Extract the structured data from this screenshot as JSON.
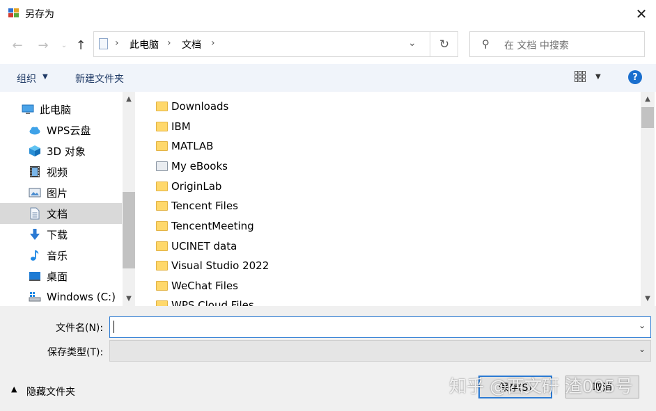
{
  "window": {
    "title": "另存为",
    "close_glyph": "✕"
  },
  "address_bar": {
    "crumbs": [
      "此电脑",
      "文档"
    ],
    "search_placeholder": "在 文档 中搜索"
  },
  "toolbar": {
    "organize_label": "组织",
    "new_folder_label": "新建文件夹",
    "help_label": "?"
  },
  "nav_pane": {
    "items": [
      {
        "label": "此电脑",
        "icon": "computer-icon"
      },
      {
        "label": "WPS云盘",
        "icon": "cloud-icon"
      },
      {
        "label": "3D 对象",
        "icon": "3d-objects-icon"
      },
      {
        "label": "视频",
        "icon": "video-icon"
      },
      {
        "label": "图片",
        "icon": "pictures-icon"
      },
      {
        "label": "文档",
        "icon": "documents-icon",
        "selected": true
      },
      {
        "label": "下载",
        "icon": "download-icon"
      },
      {
        "label": "音乐",
        "icon": "music-icon"
      },
      {
        "label": "桌面",
        "icon": "desktop-icon"
      },
      {
        "label": "Windows (C:)",
        "icon": "drive-icon"
      }
    ]
  },
  "files": [
    {
      "name": "Downloads",
      "icon": "folder-icon"
    },
    {
      "name": "IBM",
      "icon": "folder-icon"
    },
    {
      "name": "MATLAB",
      "icon": "folder-icon"
    },
    {
      "name": "My eBooks",
      "icon": "ebook-folder-icon"
    },
    {
      "name": "OriginLab",
      "icon": "folder-icon"
    },
    {
      "name": "Tencent Files",
      "icon": "folder-icon"
    },
    {
      "name": "TencentMeeting",
      "icon": "folder-icon"
    },
    {
      "name": "UCINET data",
      "icon": "folder-icon"
    },
    {
      "name": "Visual Studio 2022",
      "icon": "folder-icon"
    },
    {
      "name": "WeChat Files",
      "icon": "folder-icon"
    },
    {
      "name": "WPS Cloud Files",
      "icon": "folder-icon"
    }
  ],
  "form": {
    "filename_label": "文件名(N):",
    "filename_value": "",
    "filetype_label": "保存类型(T):",
    "filetype_value": ""
  },
  "footer": {
    "hide_folders_label": "隐藏文件夹",
    "save_label": "保存(S)",
    "cancel_label": "取消"
  },
  "watermark": "知乎 @西文研 渣005号",
  "colors": {
    "accent": "#2b7ad3",
    "toolbar_bg": "#f0f4fa",
    "folder": "#ffd86b",
    "selection": "#d9d9d9"
  }
}
